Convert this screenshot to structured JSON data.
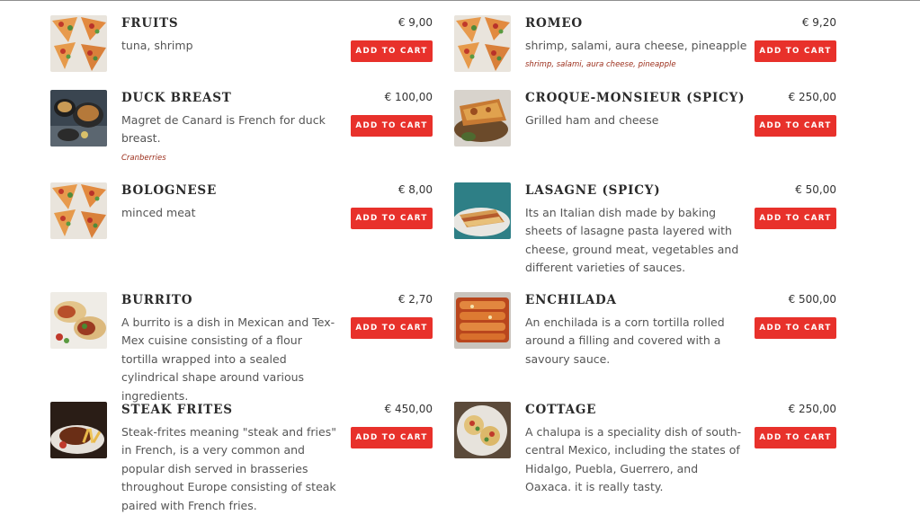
{
  "menu": {
    "items": [
      {
        "name": "FRUITS",
        "price": "€ 9,00",
        "cart_label": "ADD TO CART",
        "description": "tuna, shrimp",
        "tag": "",
        "image": "pizza-slices-photo"
      },
      {
        "name": "ROMEO",
        "price": "€ 9,20",
        "cart_label": "ADD TO CART",
        "description": "shrimp, salami, aura cheese, pineapple",
        "tag": "shrimp, salami, aura cheese, pineapple",
        "image": "pizza-slices-photo"
      },
      {
        "name": "DUCK BREAST",
        "price": "€ 100,00",
        "cart_label": "ADD TO CART",
        "description": "Magret de Canard is French for duck breast.",
        "tag": "Cranberries",
        "image": "duck-breast-photo"
      },
      {
        "name": "CROQUE-MONSIEUR (SPICY)",
        "price": "€ 250,00",
        "cart_label": "ADD TO CART",
        "description": "Grilled ham and cheese",
        "tag": "",
        "image": "croque-monsieur-photo"
      },
      {
        "name": "BOLOGNESE",
        "price": "€ 8,00",
        "cart_label": "ADD TO CART",
        "description": "minced meat",
        "tag": "",
        "image": "pizza-slices-photo"
      },
      {
        "name": "LASAGNE (SPICY)",
        "price": "€ 50,00",
        "cart_label": "ADD TO CART",
        "description": "Its an Italian dish made by baking sheets of lasagne pasta layered with cheese, ground meat, vegetables and different varieties of sauces.",
        "tag": "",
        "image": "lasagne-photo"
      },
      {
        "name": "BURRITO",
        "price": "€ 2,70",
        "cart_label": "ADD TO CART",
        "description": "A burrito is a dish in Mexican and Tex-Mex cuisine consisting of a flour tortilla wrapped into a sealed cylindrical shape around various ingredients.",
        "tag": "",
        "image": "burrito-photo"
      },
      {
        "name": "ENCHILADA",
        "price": "€ 500,00",
        "cart_label": "ADD TO CART",
        "description": "An enchilada is a corn tortilla rolled around a filling and covered with a savoury sauce.",
        "tag": "",
        "image": "enchilada-photo"
      },
      {
        "name": "STEAK FRITES",
        "price": "€ 450,00",
        "cart_label": "ADD TO CART",
        "description": "Steak-frites meaning \"steak and fries\" in French, is a very common and popular dish served in brasseries throughout Europe consisting of steak paired with French fries.",
        "tag": "",
        "image": "steak-frites-photo"
      },
      {
        "name": "COTTAGE",
        "price": "€ 250,00",
        "cart_label": "ADD TO CART",
        "description": "A chalupa is a speciality dish of south-central Mexico, including the states of Hidalgo, Puebla, Guerrero, and Oaxaca. it is really tasty.",
        "tag": "",
        "image": "chalupa-photo"
      }
    ]
  },
  "colors": {
    "button": "#e8312b",
    "tag": "#9b2d1a",
    "title": "#2b2b2b",
    "text": "#555555"
  }
}
